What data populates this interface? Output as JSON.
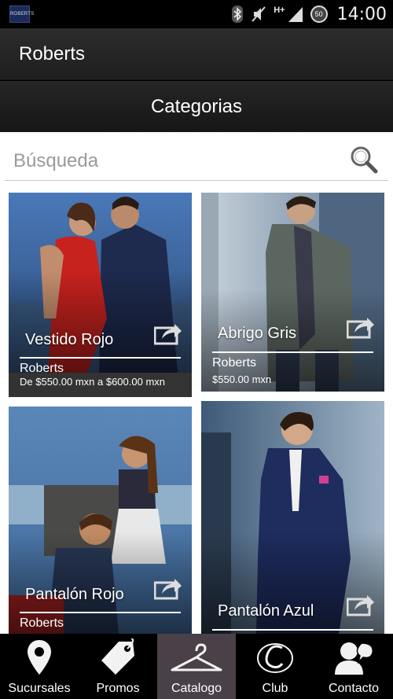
{
  "status_bar": {
    "app_badge": "ROBERTS",
    "network": "H+",
    "battery": "50",
    "time": "14:00"
  },
  "action_bar": {
    "title": "Roberts"
  },
  "category_bar": {
    "title": "Categorias"
  },
  "search": {
    "placeholder": "Búsqueda"
  },
  "cards": [
    {
      "name": "Vestido Rojo",
      "brand": "Roberts",
      "price": "De $550.00 mxn a $600.00 mxn"
    },
    {
      "name": "Abrigo Gris",
      "brand": "Roberts",
      "price": "$550.00 mxn"
    },
    {
      "name": "Pantalón Rojo",
      "brand": "Roberts",
      "price": ""
    },
    {
      "name": "Pantalón Azul",
      "brand": "",
      "price": ""
    }
  ],
  "nav": {
    "items": [
      {
        "label": "Sucursales",
        "icon": "map-pin-icon"
      },
      {
        "label": "Promos",
        "icon": "price-tag-icon"
      },
      {
        "label": "Catalogo",
        "icon": "hanger-icon"
      },
      {
        "label": "Club",
        "icon": "club-logo-icon"
      },
      {
        "label": "Contacto",
        "icon": "contact-user-icon"
      }
    ],
    "active": "Catalogo"
  },
  "colors": {
    "active_tab": "#4a4048",
    "bar_bg": "#1f1f1f",
    "content_bg": "#ffffff"
  }
}
